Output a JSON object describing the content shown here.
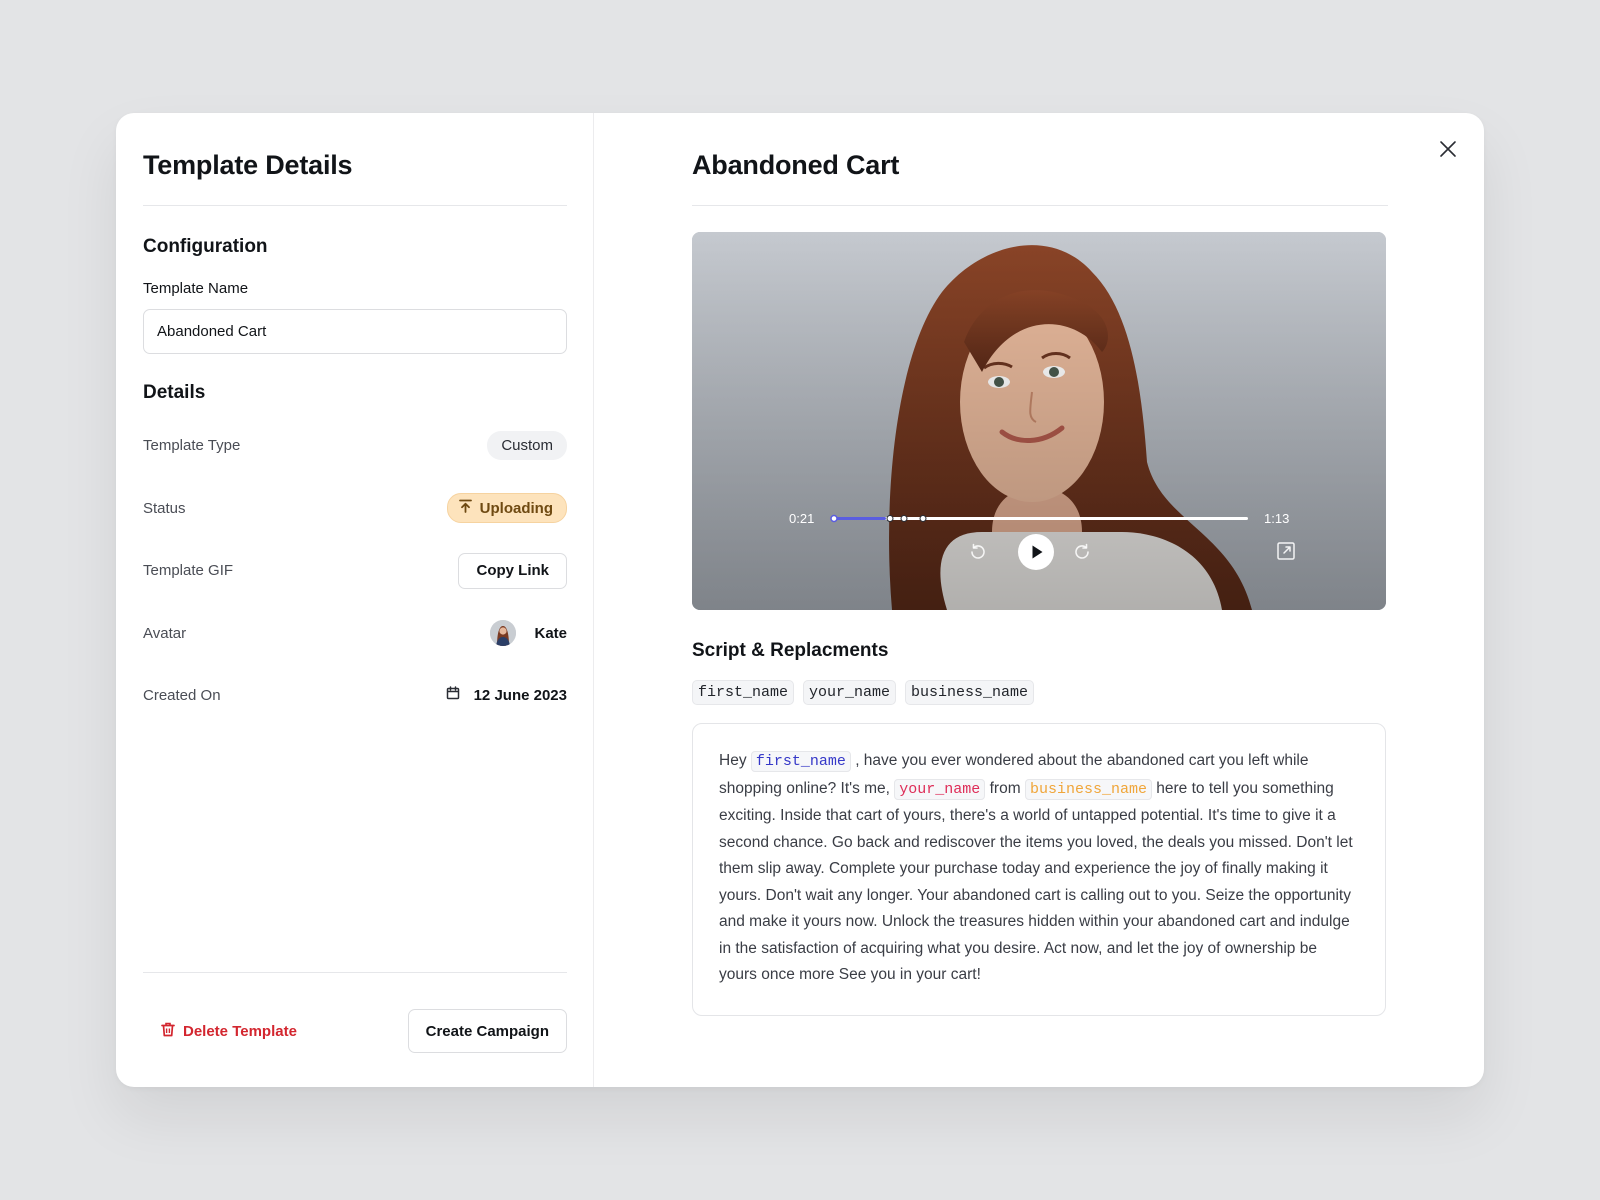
{
  "left": {
    "title": "Template Details",
    "configuration_title": "Configuration",
    "template_name_label": "Template Name",
    "template_name_value": "Abandoned Cart",
    "details_title": "Details",
    "rows": {
      "type_label": "Template Type",
      "type_value": "Custom",
      "status_label": "Status",
      "status_value": "Uploading",
      "gif_label": "Template GIF",
      "gif_button": "Copy Link",
      "avatar_label": "Avatar",
      "avatar_value": "Kate",
      "created_label": "Created On",
      "created_value": "12 June 2023"
    },
    "footer": {
      "delete_label": "Delete Template",
      "create_label": "Create Campaign"
    }
  },
  "right": {
    "title": "Abandoned Cart",
    "video": {
      "current_time": "0:21",
      "duration": "1:13",
      "progress": 0.13
    },
    "script_title": "Script & Replacments",
    "tokens": [
      "first_name",
      "your_name",
      "business_name"
    ],
    "script": {
      "p1": "Hey ",
      "t1": "first_name",
      "p2": " , have you ever wondered about the abandoned cart you left while shopping online? It's me, ",
      "t2": "your_name",
      "p3": " from ",
      "t3": "business_name",
      "p4": " here to tell you something exciting. Inside that cart of yours, there's a world of untapped potential. It's time to give it a second chance. Go back and rediscover the items you loved, the deals you missed. Don't let them slip away. Complete your purchase today and experience the joy of finally making it yours. Don't wait any longer. Your abandoned cart is calling out to you. Seize the opportunity and make it yours now. Unlock the treasures hidden within your abandoned cart and indulge in the satisfaction of acquiring what you desire. Act now, and let the joy of ownership be yours once more See you in your cart!"
    }
  },
  "icons": {
    "close": "close-icon",
    "upload": "upload-icon",
    "calendar": "calendar-icon",
    "trash": "trash-icon",
    "play": "play-icon",
    "rewind": "rewind-icon",
    "forward": "forward-icon",
    "expand": "expand-icon"
  },
  "colors": {
    "accent": "#5a5de0",
    "danger": "#d3262f",
    "status_bg": "#fde3bc"
  }
}
